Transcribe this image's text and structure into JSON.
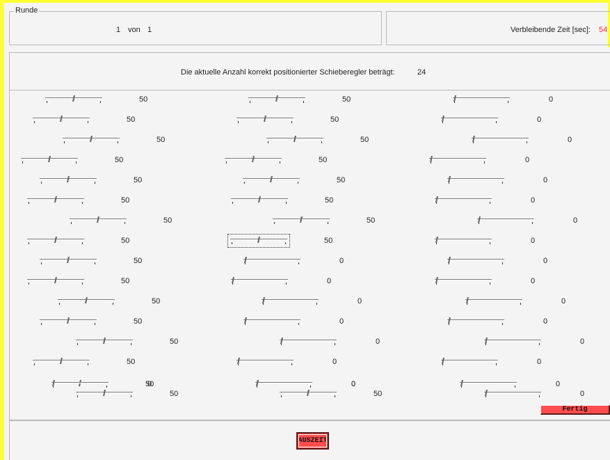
{
  "round": {
    "group_title": "Runde",
    "current": "1",
    "separator": "von",
    "total": "1"
  },
  "timer": {
    "label": "Verbleibende Zeit [sec]:",
    "value": "54",
    "value_color": "#ff2a2a"
  },
  "status": {
    "label": "Die aktuelle Anzahl korrekt positionierter Schieberegler beträgt:",
    "value": "24"
  },
  "sliders": [
    {
      "value": "50",
      "level": 50
    },
    {
      "value": "50",
      "level": 50
    },
    {
      "value": "0",
      "level": 0
    },
    {
      "value": "50",
      "level": 50
    },
    {
      "value": "50",
      "level": 50
    },
    {
      "value": "0",
      "level": 0
    },
    {
      "value": "50",
      "level": 50
    },
    {
      "value": "50",
      "level": 50
    },
    {
      "value": "0",
      "level": 0
    },
    {
      "value": "50",
      "level": 50
    },
    {
      "value": "50",
      "level": 50
    },
    {
      "value": "0",
      "level": 0
    },
    {
      "value": "50",
      "level": 50
    },
    {
      "value": "50",
      "level": 50
    },
    {
      "value": "0",
      "level": 0
    },
    {
      "value": "50",
      "level": 50
    },
    {
      "value": "50",
      "level": 50
    },
    {
      "value": "0",
      "level": 0
    },
    {
      "value": "50",
      "level": 50
    },
    {
      "value": "50",
      "level": 50
    },
    {
      "value": "0",
      "level": 0
    },
    {
      "value": "50",
      "level": 50
    },
    {
      "value": "50",
      "level": 50
    },
    {
      "value": "0",
      "level": 0
    },
    {
      "value": "50",
      "level": 50
    },
    {
      "value": "0",
      "level": 0
    },
    {
      "value": "0",
      "level": 0
    },
    {
      "value": "50",
      "level": 50
    },
    {
      "value": "0",
      "level": 0
    },
    {
      "value": "0",
      "level": 0
    },
    {
      "value": "50",
      "level": 50
    },
    {
      "value": "0",
      "level": 0
    },
    {
      "value": "0",
      "level": 0
    },
    {
      "value": "50",
      "level": 50
    },
    {
      "value": "0",
      "level": 0
    },
    {
      "value": "0",
      "level": 0
    },
    {
      "value": "50",
      "level": 50
    },
    {
      "value": "0",
      "level": 0
    },
    {
      "value": "0",
      "level": 0
    },
    {
      "value": "50",
      "level": 50
    },
    {
      "value": "0",
      "level": 0
    },
    {
      "value": "0",
      "level": 0
    },
    {
      "value": "50",
      "level": 50
    },
    {
      "value": "0",
      "level": 0
    },
    {
      "value": "0",
      "level": 0
    },
    {
      "value": "50",
      "level": 50
    },
    {
      "value": "50",
      "level": 50
    },
    {
      "value": "0",
      "level": 0
    },
    {
      "value": "0",
      "level": 0
    },
    {
      "value": "0",
      "level": 0
    }
  ],
  "buttons": {
    "fertig_label": "Fertig",
    "auszeit_label": "AUSZEIT",
    "color": "#ff4d4d"
  }
}
